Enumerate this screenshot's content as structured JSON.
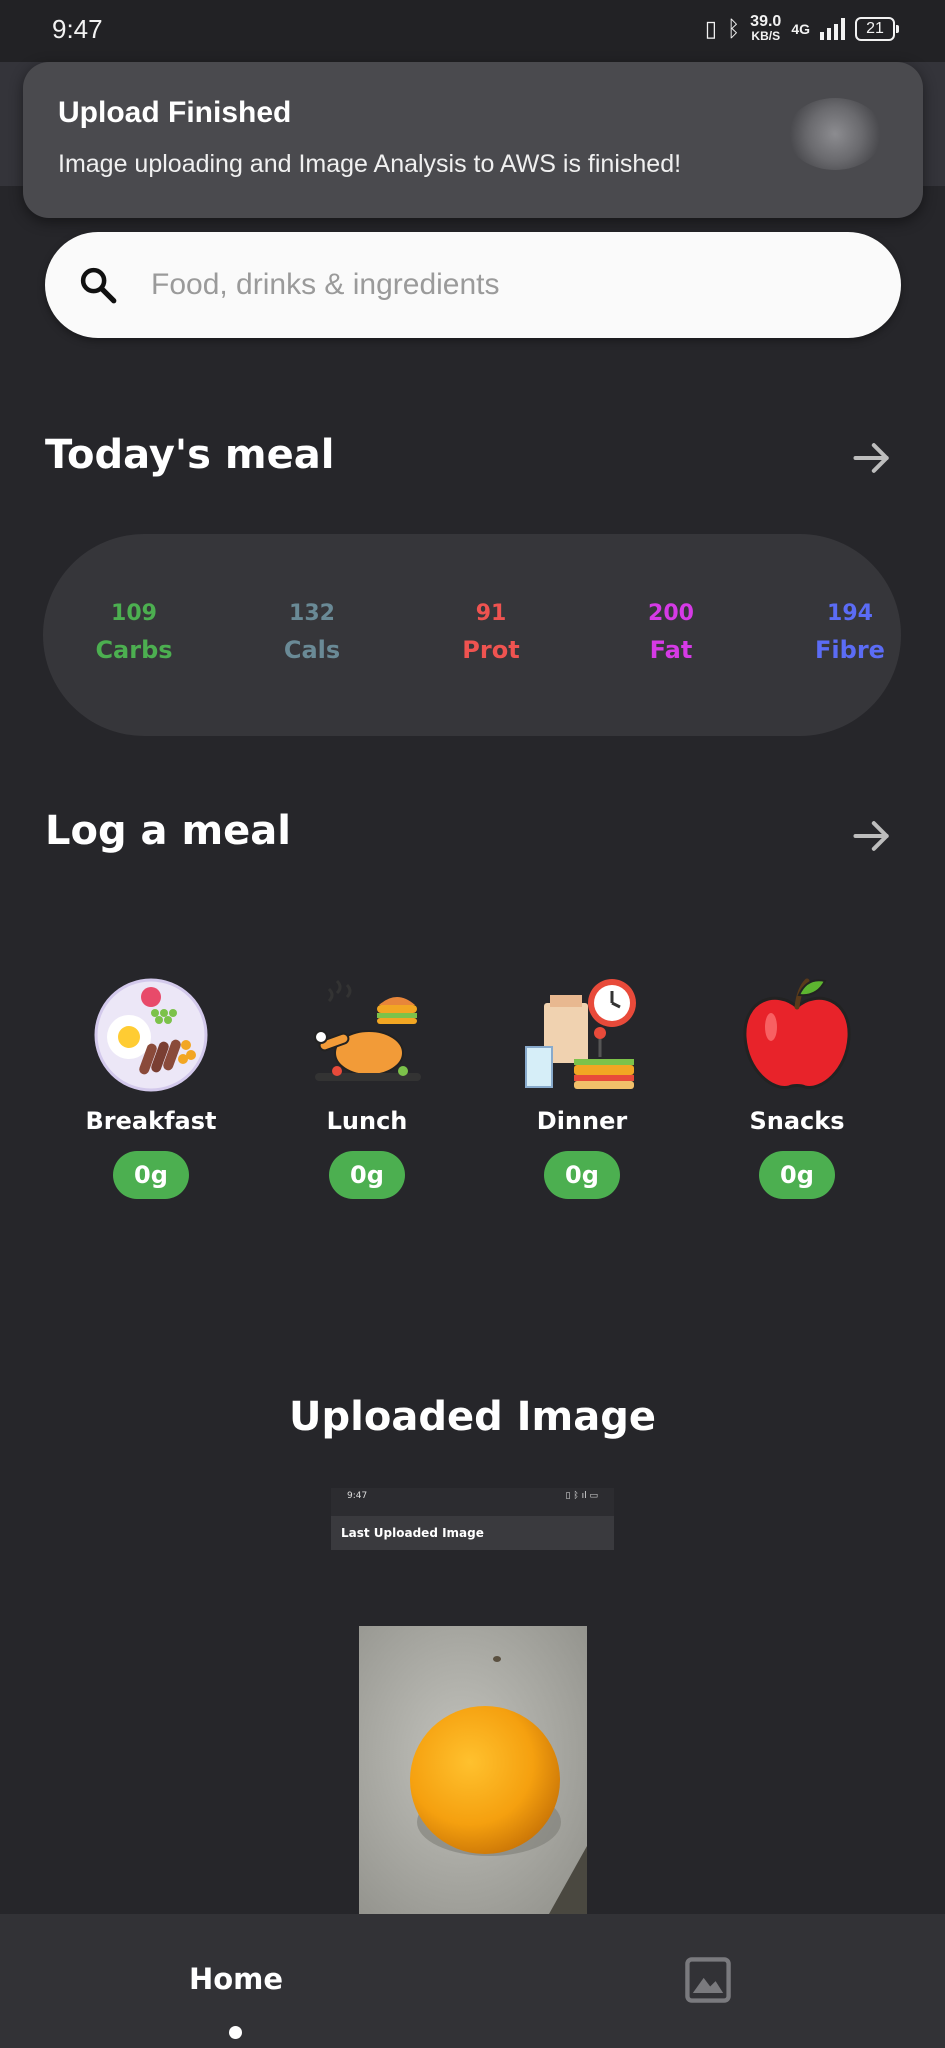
{
  "status_bar": {
    "time": "9:47",
    "speed_value": "39.0",
    "speed_unit": "KB/S",
    "network": "4G",
    "battery": "21"
  },
  "notification": {
    "title": "Upload Finished",
    "body": "Image uploading and Image Analysis to AWS is finished!"
  },
  "search": {
    "placeholder": "Food, drinks & ingredients",
    "value": ""
  },
  "todays_meal": {
    "title": "Today's meal",
    "macros": [
      {
        "value": "109",
        "label": "Carbs",
        "color": "#4caf50"
      },
      {
        "value": "132",
        "label": "Cals",
        "color": "#6a8a96"
      },
      {
        "value": "91",
        "label": "Prot",
        "color": "#ef5350"
      },
      {
        "value": "200",
        "label": "Fat",
        "color": "#d63ae6"
      },
      {
        "value": "194",
        "label": "Fibre",
        "color": "#5b6cf5"
      }
    ]
  },
  "log_meal": {
    "title": "Log a meal",
    "meals": [
      {
        "label": "Breakfast",
        "amount": "0g"
      },
      {
        "label": "Lunch",
        "amount": "0g"
      },
      {
        "label": "Dinner",
        "amount": "0g"
      },
      {
        "label": "Snacks",
        "amount": "0g"
      }
    ]
  },
  "uploaded": {
    "title": "Uploaded Image",
    "embedded_time": "9:47",
    "embedded_title": "Last Uploaded Image"
  },
  "bottom_nav": {
    "home_label": "Home",
    "gallery_icon": "image-icon"
  },
  "colors": {
    "accent_green": "#4caf50",
    "background": "#26262a"
  }
}
